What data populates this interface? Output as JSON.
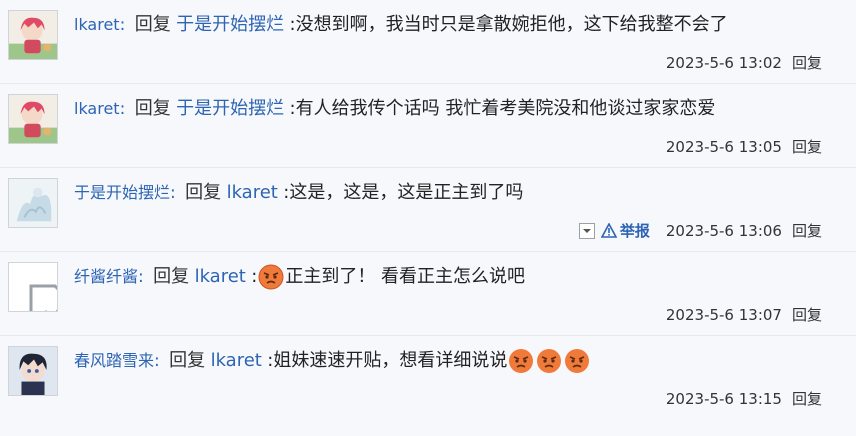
{
  "comments": [
    {
      "user": "lkaret",
      "reply_word": "回复",
      "target": "于是开始摆烂",
      "text": ":没想到啊，我当时只是拿散婉拒他，这下给我整不会了",
      "time": "2023-5-6 13:02",
      "reply_link": "回复"
    },
    {
      "user": "lkaret",
      "reply_word": "回复",
      "target": "于是开始摆烂",
      "text": ":有人给我传个话吗 我忙着考美院没和他谈过家家恋爱",
      "time": "2023-5-6 13:05",
      "reply_link": "回复"
    },
    {
      "user": "于是开始摆烂",
      "reply_word": "回复",
      "target": "lkaret",
      "text": ":这是，这是，这是正主到了吗",
      "time": "2023-5-6 13:06",
      "reply_link": "回复",
      "report_label": "举报"
    },
    {
      "user": "纤酱纤酱",
      "reply_word": "回复",
      "target": "lkaret",
      "text_prefix": ":",
      "text": "正主到了！ 看看正主怎么说吧",
      "time": "2023-5-6 13:07",
      "reply_link": "回复"
    },
    {
      "user": "春风踏雪来",
      "reply_word": "回复",
      "target": "lkaret",
      "text": ":姐妹速速开贴，想看详细说说",
      "time": "2023-5-6 13:15",
      "reply_link": "回复"
    }
  ],
  "icons": {
    "report": "warning-triangle-icon",
    "dropdown": "chevron-down-icon",
    "emoji": "angry-face-emoji"
  }
}
